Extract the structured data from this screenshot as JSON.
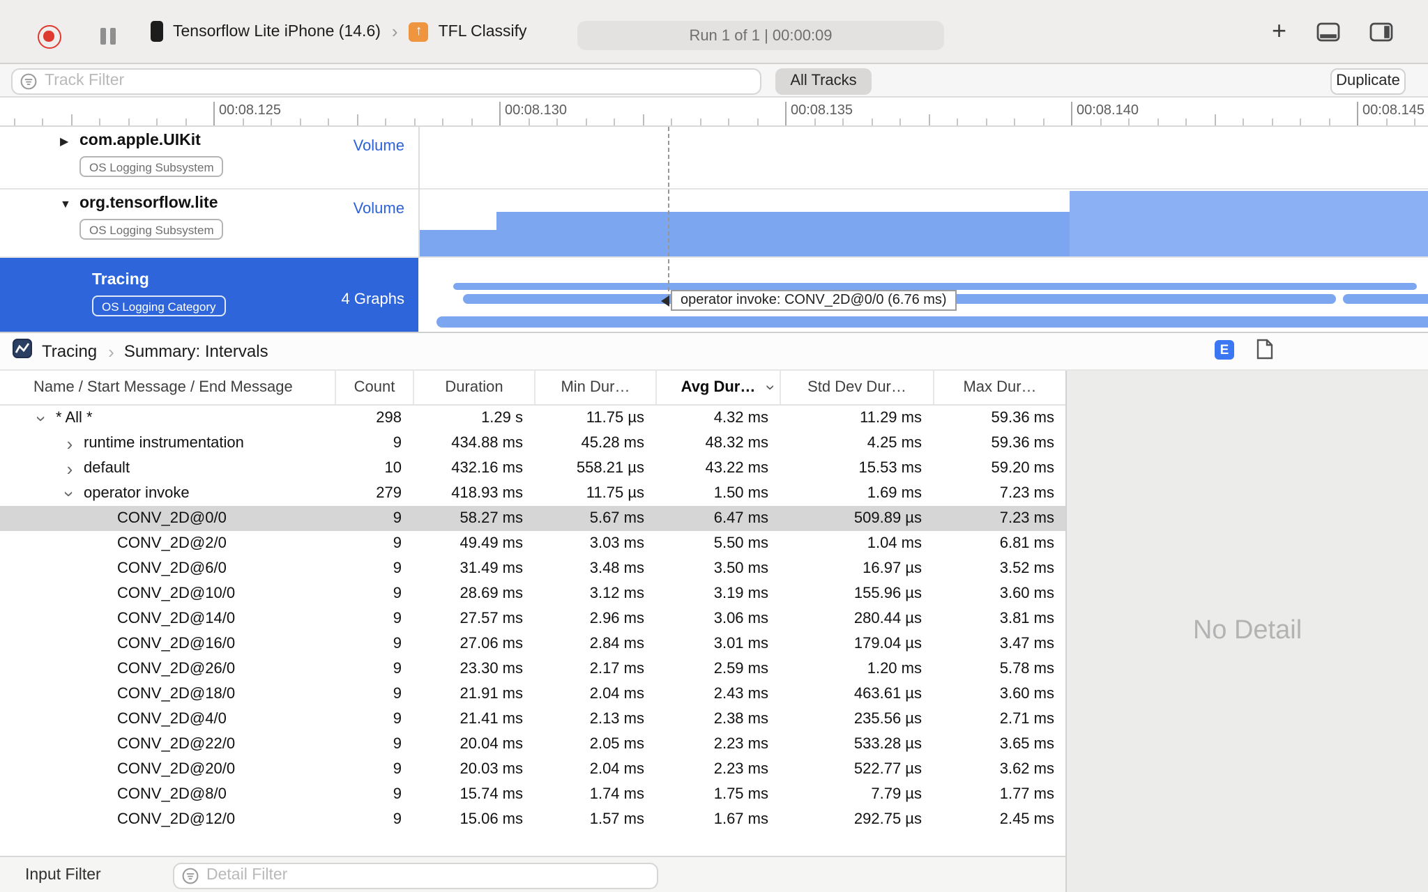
{
  "colors": {
    "accent_blue": "#2e65da",
    "interval_bar_blue": "#7da6f1",
    "volume_bright_blue": "#8bb0f3",
    "record_red": "#df3a30",
    "target_orange": "#f0953f",
    "inactive_selection_gray": "#d6d6d6",
    "inspector_badge_blue": "#3b77f2"
  },
  "toolbar": {
    "device_name": "Tensorflow Lite iPhone (14.6)",
    "target_name": "TFL Classify",
    "run_status": "Run 1 of 1  |  00:00:09"
  },
  "filter_bar": {
    "track_filter_placeholder": "Track Filter",
    "all_tracks_label": "All Tracks",
    "duplicate_label": "Duplicate"
  },
  "ruler": {
    "labels": [
      "00:08.125",
      "00:08.130",
      "00:08.135",
      "00:08.140",
      "00:08.145"
    ]
  },
  "tracks": {
    "rows": [
      {
        "name": "com.apple.UIKit",
        "badge": "OS Logging Subsystem",
        "meta": "Volume"
      },
      {
        "name": "org.tensorflow.lite",
        "badge": "OS Logging Subsystem",
        "meta": "Volume"
      },
      {
        "name": "Tracing",
        "badge": "OS Logging Category",
        "meta": "4 Graphs"
      }
    ],
    "tooltip": "operator invoke: CONV_2D@0/0 (6.76 ms)"
  },
  "detail": {
    "breadcrumb_root": "Tracing",
    "breadcrumb_page": "Summary: Intervals",
    "inspector_badge": "E",
    "no_detail": "No Detail",
    "columns": [
      "Name / Start Message / End Message",
      "Count",
      "Duration",
      "Min Dur…",
      "Avg Dur…",
      "Std Dev Dur…",
      "Max Dur…"
    ],
    "rows": [
      {
        "depth": 0,
        "expand": "open",
        "selected": false,
        "name": "* All *",
        "values": [
          "298",
          "1.29 s",
          "11.75 µs",
          "4.32 ms",
          "11.29 ms",
          "59.36 ms"
        ]
      },
      {
        "depth": 1,
        "expand": "closed",
        "selected": false,
        "name": "runtime instrumentation",
        "values": [
          "9",
          "434.88 ms",
          "45.28 ms",
          "48.32 ms",
          "4.25 ms",
          "59.36 ms"
        ]
      },
      {
        "depth": 1,
        "expand": "closed",
        "selected": false,
        "name": "default",
        "values": [
          "10",
          "432.16 ms",
          "558.21 µs",
          "43.22 ms",
          "15.53 ms",
          "59.20 ms"
        ]
      },
      {
        "depth": 1,
        "expand": "open",
        "selected": false,
        "name": "operator invoke",
        "values": [
          "279",
          "418.93 ms",
          "11.75 µs",
          "1.50 ms",
          "1.69 ms",
          "7.23 ms"
        ]
      },
      {
        "depth": 2,
        "expand": "none",
        "selected": true,
        "name": "CONV_2D@0/0",
        "values": [
          "9",
          "58.27 ms",
          "5.67 ms",
          "6.47 ms",
          "509.89 µs",
          "7.23 ms"
        ]
      },
      {
        "depth": 2,
        "expand": "none",
        "selected": false,
        "name": "CONV_2D@2/0",
        "values": [
          "9",
          "49.49 ms",
          "3.03 ms",
          "5.50 ms",
          "1.04 ms",
          "6.81 ms"
        ]
      },
      {
        "depth": 2,
        "expand": "none",
        "selected": false,
        "name": "CONV_2D@6/0",
        "values": [
          "9",
          "31.49 ms",
          "3.48 ms",
          "3.50 ms",
          "16.97 µs",
          "3.52 ms"
        ]
      },
      {
        "depth": 2,
        "expand": "none",
        "selected": false,
        "name": "CONV_2D@10/0",
        "values": [
          "9",
          "28.69 ms",
          "3.12 ms",
          "3.19 ms",
          "155.96 µs",
          "3.60 ms"
        ]
      },
      {
        "depth": 2,
        "expand": "none",
        "selected": false,
        "name": "CONV_2D@14/0",
        "values": [
          "9",
          "27.57 ms",
          "2.96 ms",
          "3.06 ms",
          "280.44 µs",
          "3.81 ms"
        ]
      },
      {
        "depth": 2,
        "expand": "none",
        "selected": false,
        "name": "CONV_2D@16/0",
        "values": [
          "9",
          "27.06 ms",
          "2.84 ms",
          "3.01 ms",
          "179.04 µs",
          "3.47 ms"
        ]
      },
      {
        "depth": 2,
        "expand": "none",
        "selected": false,
        "name": "CONV_2D@26/0",
        "values": [
          "9",
          "23.30 ms",
          "2.17 ms",
          "2.59 ms",
          "1.20 ms",
          "5.78 ms"
        ]
      },
      {
        "depth": 2,
        "expand": "none",
        "selected": false,
        "name": "CONV_2D@18/0",
        "values": [
          "9",
          "21.91 ms",
          "2.04 ms",
          "2.43 ms",
          "463.61 µs",
          "3.60 ms"
        ]
      },
      {
        "depth": 2,
        "expand": "none",
        "selected": false,
        "name": "CONV_2D@4/0",
        "values": [
          "9",
          "21.41 ms",
          "2.13 ms",
          "2.38 ms",
          "235.56 µs",
          "2.71 ms"
        ]
      },
      {
        "depth": 2,
        "expand": "none",
        "selected": false,
        "name": "CONV_2D@22/0",
        "values": [
          "9",
          "20.04 ms",
          "2.05 ms",
          "2.23 ms",
          "533.28 µs",
          "3.65 ms"
        ]
      },
      {
        "depth": 2,
        "expand": "none",
        "selected": false,
        "name": "CONV_2D@20/0",
        "values": [
          "9",
          "20.03 ms",
          "2.04 ms",
          "2.23 ms",
          "522.77 µs",
          "3.62 ms"
        ]
      },
      {
        "depth": 2,
        "expand": "none",
        "selected": false,
        "name": "CONV_2D@8/0",
        "values": [
          "9",
          "15.74 ms",
          "1.74 ms",
          "1.75 ms",
          "7.79 µs",
          "1.77 ms"
        ]
      },
      {
        "depth": 2,
        "expand": "none",
        "selected": false,
        "name": "CONV_2D@12/0",
        "values": [
          "9",
          "15.06 ms",
          "1.57 ms",
          "1.67 ms",
          "292.75 µs",
          "2.45 ms"
        ]
      }
    ]
  },
  "bottom_bar": {
    "label": "Input Filter",
    "detail_filter_placeholder": "Detail Filter"
  }
}
